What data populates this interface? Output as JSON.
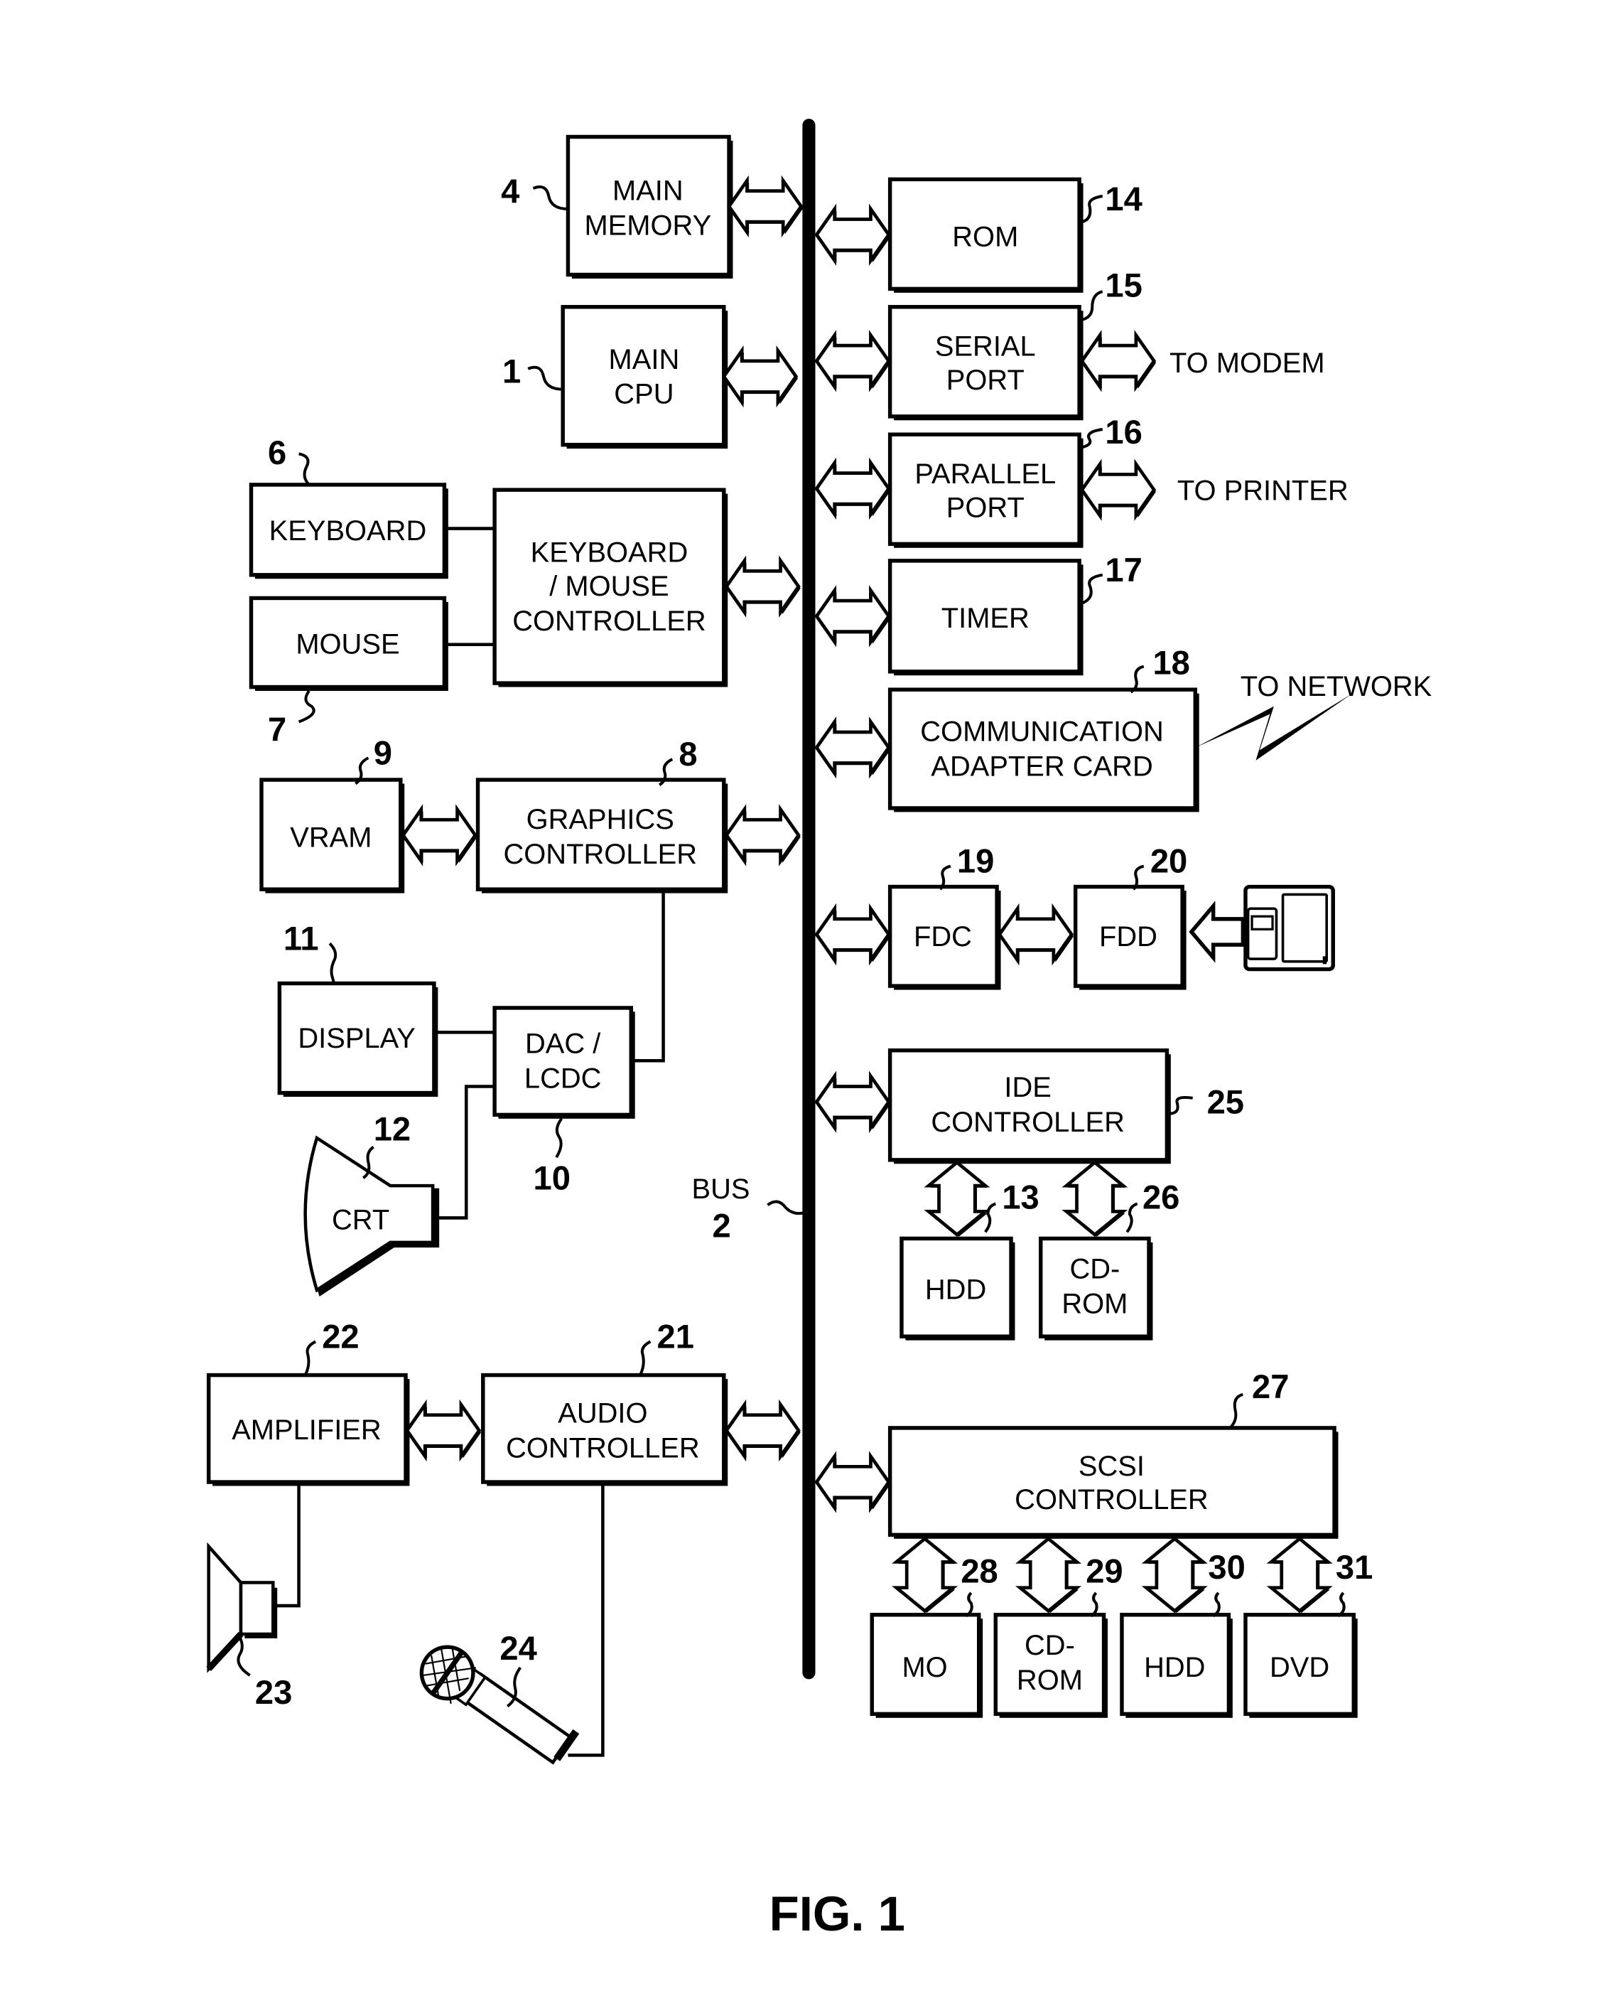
{
  "figure": {
    "caption": "FIG. 1",
    "bus_label": "BUS",
    "bus_ref": "2"
  },
  "left": {
    "main_memory": {
      "line1": "MAIN",
      "line2": "MEMORY",
      "ref": "4"
    },
    "main_cpu": {
      "line1": "MAIN",
      "line2": "CPU",
      "ref": "1"
    },
    "keyboard": {
      "label": "KEYBOARD",
      "ref": "6"
    },
    "mouse": {
      "label": "MOUSE",
      "ref": "7"
    },
    "kbm_controller": {
      "line1": "KEYBOARD",
      "line2": "/ MOUSE",
      "line3": "CONTROLLER"
    },
    "vram": {
      "label": "VRAM",
      "ref": "9"
    },
    "graphics_controller": {
      "line1": "GRAPHICS",
      "line2": "CONTROLLER",
      "ref": "8"
    },
    "display": {
      "label": "DISPLAY",
      "ref": "11"
    },
    "dac_lcdc": {
      "line1": "DAC /",
      "line2": "LCDC",
      "ref": "10"
    },
    "crt": {
      "label": "CRT",
      "ref": "12"
    },
    "amplifier": {
      "label": "AMPLIFIER",
      "ref": "22"
    },
    "audio_controller": {
      "line1": "AUDIO",
      "line2": "CONTROLLER",
      "ref": "21"
    },
    "speaker": {
      "ref": "23"
    },
    "microphone": {
      "ref": "24"
    }
  },
  "right": {
    "rom": {
      "label": "ROM",
      "ref": "14"
    },
    "serial_port": {
      "line1": "SERIAL",
      "line2": "PORT",
      "ref": "15",
      "target": "TO MODEM"
    },
    "parallel_port": {
      "line1": "PARALLEL",
      "line2": "PORT",
      "ref": "16",
      "target": "TO PRINTER"
    },
    "timer": {
      "label": "TIMER",
      "ref": "17"
    },
    "comm_adapter": {
      "line1": "COMMUNICATION",
      "line2": "ADAPTER CARD",
      "ref": "18",
      "target": "TO NETWORK"
    },
    "fdc": {
      "label": "FDC",
      "ref": "19"
    },
    "fdd": {
      "label": "FDD",
      "ref": "20"
    },
    "ide_controller": {
      "line1": "IDE",
      "line2": "CONTROLLER",
      "ref": "25"
    },
    "ide_hdd": {
      "label": "HDD",
      "ref": "13"
    },
    "ide_cdrom": {
      "line1": "CD-",
      "line2": "ROM",
      "ref": "26"
    },
    "scsi_controller": {
      "line1": "SCSI",
      "line2": "CONTROLLER",
      "ref": "27"
    },
    "scsi_mo": {
      "label": "MO",
      "ref": "28"
    },
    "scsi_cdrom": {
      "line1": "CD-",
      "line2": "ROM",
      "ref": "29"
    },
    "scsi_hdd": {
      "label": "HDD",
      "ref": "30"
    },
    "scsi_dvd": {
      "label": "DVD",
      "ref": "31"
    }
  }
}
